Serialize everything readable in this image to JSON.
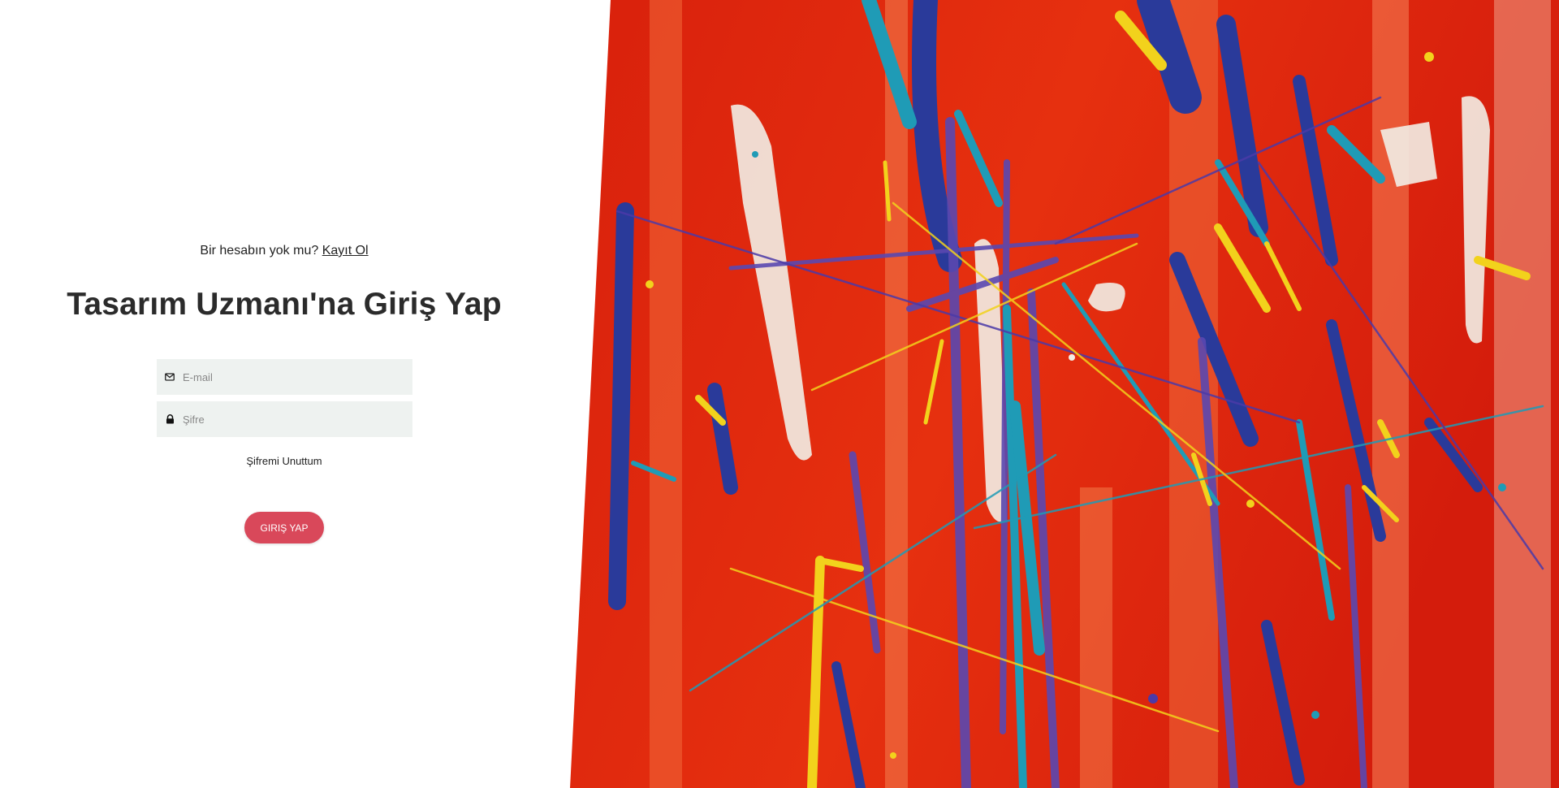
{
  "login": {
    "signup_prompt": "Bir hesabın yok mu?",
    "signup_link": "Kayıt Ol",
    "title": "Tasarım Uzmanı'na Giriş Yap",
    "email_placeholder": "E-mail",
    "password_placeholder": "Şifre",
    "forgot_password": "Şifremi Unuttum",
    "submit_label": "GIRIŞ YAP"
  },
  "icons": {
    "email": "envelope-icon",
    "password": "lock-icon"
  },
  "colors": {
    "accent": "#d9485a",
    "field_bg": "#eef2f0",
    "title": "#2b2b2b",
    "art_base": "#e0200e"
  }
}
